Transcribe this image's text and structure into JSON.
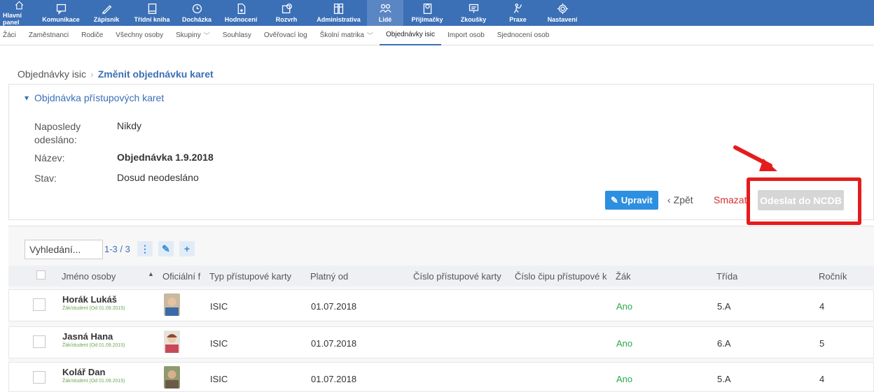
{
  "topnav": [
    {
      "label": "Hlavní panel",
      "icon": "home-icon",
      "active": false
    },
    {
      "label": "Komunikace",
      "icon": "chat-icon",
      "active": false
    },
    {
      "label": "Zápisník",
      "icon": "pencil-icon",
      "active": false
    },
    {
      "label": "Třídní kniha",
      "icon": "book-icon",
      "active": false
    },
    {
      "label": "Docházka",
      "icon": "clock-icon",
      "active": false
    },
    {
      "label": "Hodnocení",
      "icon": "grade-icon",
      "active": false
    },
    {
      "label": "Rozvrh",
      "icon": "calendar-icon",
      "active": false
    },
    {
      "label": "Administrativa",
      "icon": "cabinet-icon",
      "active": false
    },
    {
      "label": "Lidé",
      "icon": "people-icon",
      "active": true
    },
    {
      "label": "Přijímačky",
      "icon": "admission-icon",
      "active": false
    },
    {
      "label": "Zkoušky",
      "icon": "exam-icon",
      "active": false
    },
    {
      "label": "Praxe",
      "icon": "practice-icon",
      "active": false
    },
    {
      "label": "Nastavení",
      "icon": "gear-icon",
      "active": false
    }
  ],
  "subnav": [
    {
      "label": "Žáci",
      "dropdown": false,
      "active": false
    },
    {
      "label": "Zaměstnanci",
      "dropdown": false,
      "active": false
    },
    {
      "label": "Rodiče",
      "dropdown": false,
      "active": false
    },
    {
      "label": "Všechny osoby",
      "dropdown": false,
      "active": false
    },
    {
      "label": "Skupiny",
      "dropdown": true,
      "active": false
    },
    {
      "label": "Souhlasy",
      "dropdown": false,
      "active": false
    },
    {
      "label": "Ověřovací log",
      "dropdown": false,
      "active": false
    },
    {
      "label": "Školní matrika",
      "dropdown": true,
      "active": false
    },
    {
      "label": "Objednávky isic",
      "dropdown": false,
      "active": true
    },
    {
      "label": "Import osob",
      "dropdown": false,
      "active": false
    },
    {
      "label": "Sjednocení osob",
      "dropdown": false,
      "active": false
    }
  ],
  "breadcrumb": {
    "parent": "Objednávky isic",
    "current": "Změnit objednávku karet"
  },
  "detail": {
    "section_title": "Objdnávka přístupových karet",
    "last_sent_label_1": "Naposledy",
    "last_sent_label_2": "odesláno:",
    "last_sent_value": "Nikdy",
    "name_label": "Název:",
    "name_value": "Objednávka 1.9.2018",
    "state_label": "Stav:",
    "state_value": "Dosud neodesláno"
  },
  "actions": {
    "edit": "Upravit",
    "back": "Zpět",
    "delete": "Smazat",
    "send": "Odeslat do NCDB"
  },
  "table": {
    "search_placeholder": "Vyhledání...",
    "count": "1-3 / 3",
    "columns": [
      "Jméno osoby",
      "Oficiální f",
      "Typ přístupové karty",
      "Platný od",
      "Číslo přístupové karty",
      "Číslo čipu přístupové k",
      "Žák",
      "Třída",
      "Ročník"
    ],
    "rows": [
      {
        "name": "Horák Lukáš",
        "role": "Žák/student (Od 01.09.2015)",
        "card_type": "ISIC",
        "valid_from": "01.07.2018",
        "card_no": "",
        "chip_no": "",
        "pupil": "Ano",
        "class": "5.A",
        "grade": "4"
      },
      {
        "name": "Jasná Hana",
        "role": "Žák/student (Od 01.09.2015)",
        "card_type": "ISIC",
        "valid_from": "01.07.2018",
        "card_no": "",
        "chip_no": "",
        "pupil": "Ano",
        "class": "6.A",
        "grade": "5"
      },
      {
        "name": "Kolář Dan",
        "role": "Žák/student (Od 01.09.2015)",
        "card_type": "ISIC",
        "valid_from": "01.07.2018",
        "card_no": "",
        "chip_no": "",
        "pupil": "Ano",
        "class": "5.A",
        "grade": "4"
      }
    ]
  },
  "colors": {
    "nav_bg": "#3b6fb6",
    "accent": "#2d8fe0",
    "highlight": "#e51c1c",
    "yes": "#2aa84a"
  }
}
